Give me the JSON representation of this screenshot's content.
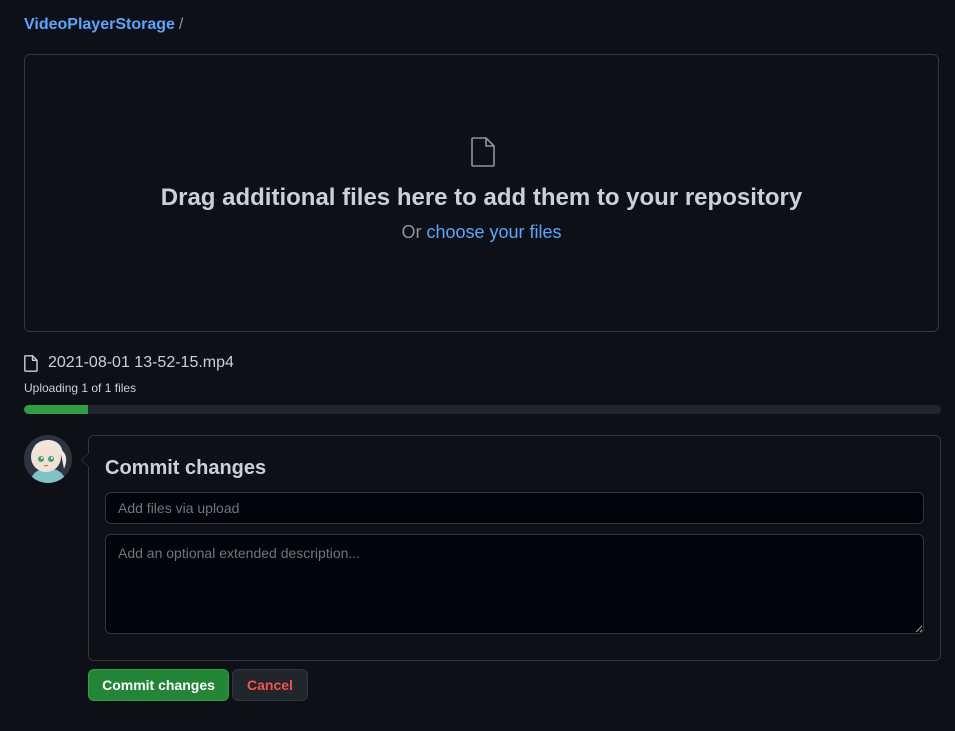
{
  "breadcrumb": {
    "repo": "VideoPlayerStorage",
    "separator": "/"
  },
  "dropzone": {
    "icon": "file-icon",
    "title": "Drag additional files here to add them to your repository",
    "or_text": "Or ",
    "choose_link": "choose your files"
  },
  "upload": {
    "file_icon": "file-icon",
    "file_name": "2021-08-01 13-52-15.mp4",
    "status": "Uploading 1 of 1 files",
    "progress_fraction": 0.07
  },
  "commit": {
    "heading": "Commit changes",
    "summary_placeholder": "Add files via upload",
    "summary_value": "",
    "description_placeholder": "Add an optional extended description...",
    "description_value": "",
    "commit_button": "Commit changes",
    "cancel_button": "Cancel"
  },
  "colors": {
    "background": "#0d1117",
    "link": "#58a6ff",
    "progress": "#2ea043",
    "commit_button": "#238636",
    "cancel_text": "#f85149"
  }
}
